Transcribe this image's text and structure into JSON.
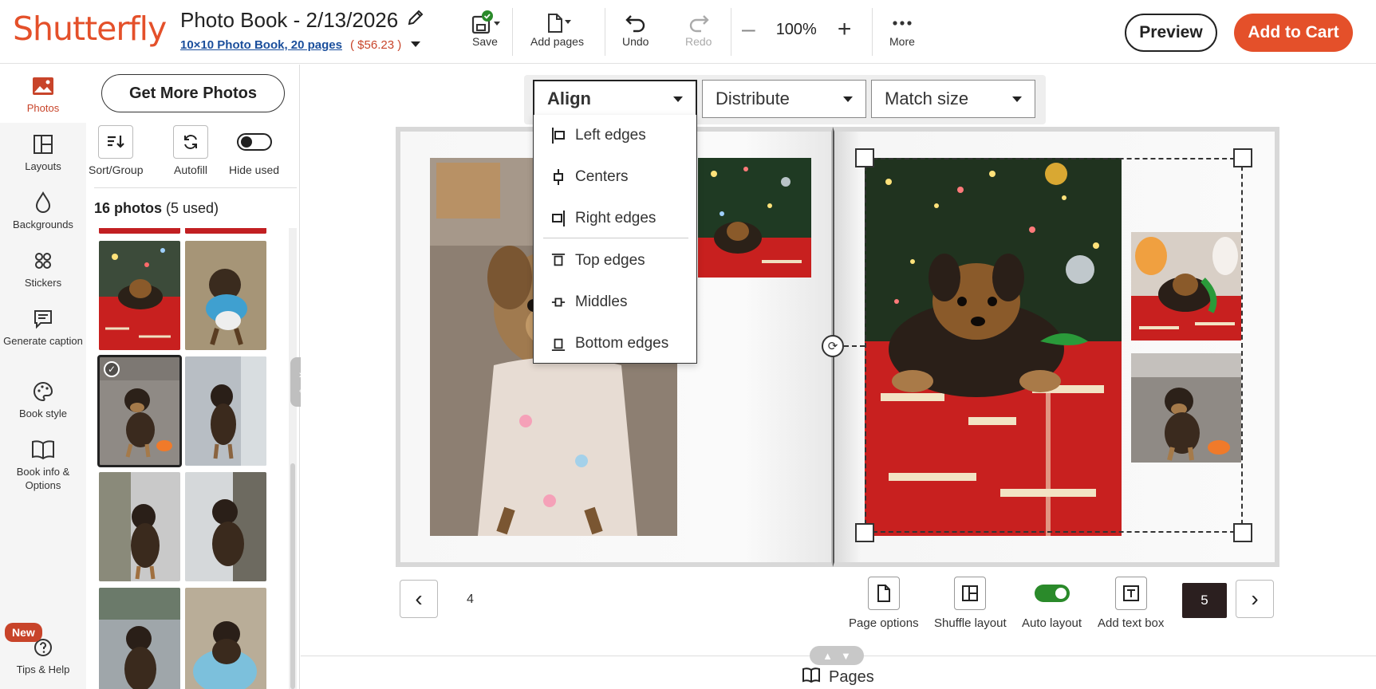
{
  "header": {
    "logo": "Shutterfly",
    "title": "Photo Book - 2/13/2026",
    "product_link": "10×10 Photo Book, 20 pages",
    "price_open": "(",
    "price": "$56.23",
    "price_close": ")",
    "save": "Save",
    "add_pages": "Add pages",
    "undo": "Undo",
    "redo": "Redo",
    "zoom": "100%",
    "more": "More",
    "preview": "Preview",
    "add_to_cart": "Add to Cart"
  },
  "rail": {
    "items": [
      {
        "label": "Photos",
        "icon": "image-icon"
      },
      {
        "label": "Layouts",
        "icon": "layout-icon"
      },
      {
        "label": "Backgrounds",
        "icon": "droplet-icon"
      },
      {
        "label": "Stickers",
        "icon": "sticker-icon"
      },
      {
        "label": "Generate caption",
        "icon": "caption-icon"
      },
      {
        "label": "Book style",
        "icon": "palette-icon"
      },
      {
        "label": "Book info & Options",
        "icon": "book-icon"
      },
      {
        "label": "Tips & Help",
        "icon": "help-icon"
      }
    ],
    "new_badge": "New"
  },
  "panel": {
    "get_more": "Get More Photos",
    "sort_group": "Sort/Group",
    "autofill": "Autofill",
    "hide_used": "Hide used",
    "count_bold": "16 photos",
    "count_rest": " (5 used)"
  },
  "align_toolbar": {
    "align": "Align",
    "distribute": "Distribute",
    "match_size": "Match size",
    "menu": [
      {
        "label": "Left edges",
        "icon": "align-left-icon"
      },
      {
        "label": "Centers",
        "icon": "align-center-icon"
      },
      {
        "label": "Right edges",
        "icon": "align-right-icon"
      },
      {
        "label": "Top edges",
        "icon": "align-top-icon"
      },
      {
        "label": "Middles",
        "icon": "align-middle-icon"
      },
      {
        "label": "Bottom edges",
        "icon": "align-bottom-icon"
      }
    ]
  },
  "page_controls": {
    "left_page": "4",
    "right_page": "5",
    "page_options": "Page options",
    "shuffle_layout": "Shuffle layout",
    "auto_layout": "Auto layout",
    "add_text_box": "Add text box"
  },
  "footer": {
    "pages": "Pages"
  },
  "colors": {
    "brand": "#e4502a",
    "link": "#1b4f9c",
    "toggle_on": "#2a8a2a"
  }
}
